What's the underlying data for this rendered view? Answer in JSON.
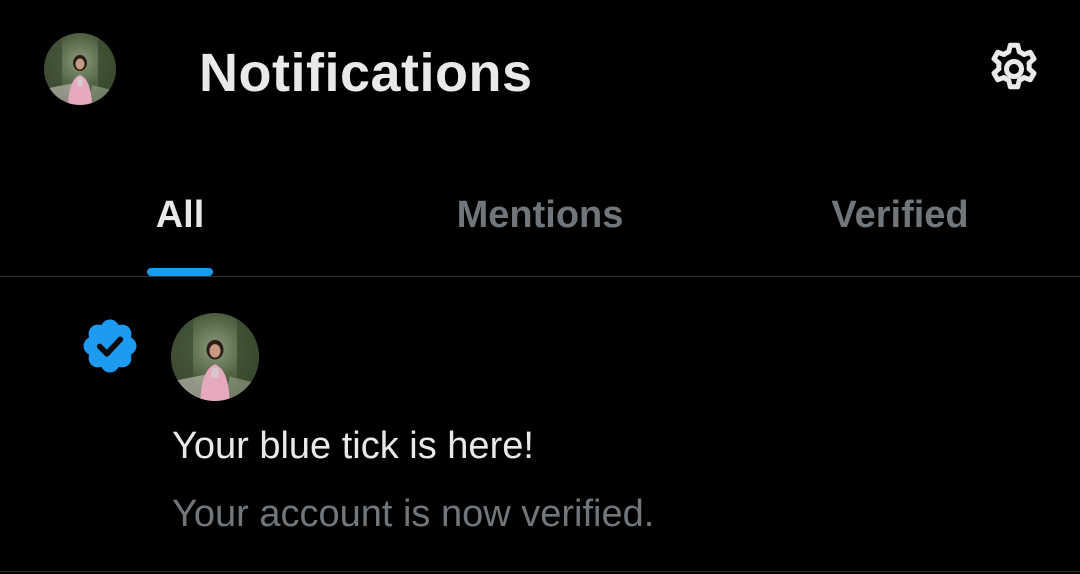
{
  "header": {
    "title": "Notifications",
    "avatar_icon": "profile-photo-icon",
    "settings_icon": "gear-icon"
  },
  "tabs": [
    {
      "label": "All",
      "active": true
    },
    {
      "label": "Mentions",
      "active": false
    },
    {
      "label": "Verified",
      "active": false
    }
  ],
  "notification": {
    "icon": "verified-badge-icon",
    "avatar_icon": "profile-photo-icon",
    "title": "Your blue tick is here!",
    "body": "Your account is now verified."
  },
  "colors": {
    "background": "#000000",
    "primary_text": "#e7e9ea",
    "secondary_text": "#71767b",
    "accent": "#1d9bf0",
    "divider": "#2f3336"
  }
}
